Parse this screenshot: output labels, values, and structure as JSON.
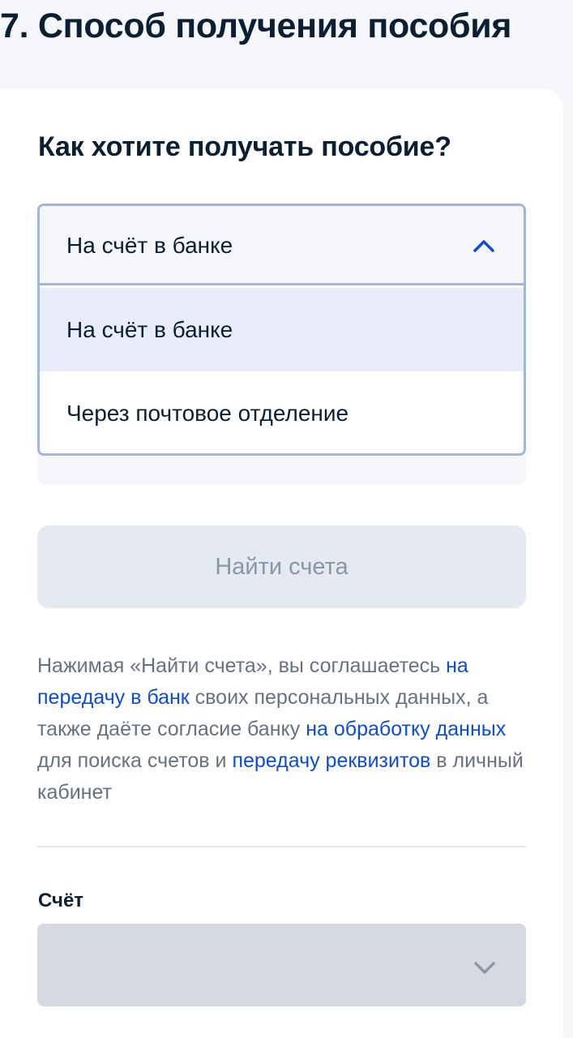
{
  "section": {
    "title": "7. Способ получения пособия"
  },
  "form": {
    "question": "Как хотите получать пособие?",
    "payment_method": {
      "selected": "На счёт в банке",
      "expanded": true,
      "options": [
        {
          "label": "На счёт в банке",
          "selected": true
        },
        {
          "label": "Через почтовое отделение",
          "selected": false
        }
      ],
      "icon": "chevron-up-icon"
    },
    "find_button": {
      "label": "Найти счета",
      "disabled": true
    },
    "consent": {
      "part1": "Нажимая «Найти счета», вы соглашаетесь ",
      "link1": "на передачу в банк",
      "part2": " своих персональных данных, а также даёте согласие банку ",
      "link2": "на обработку данных",
      "part3": " для поиска счетов и ",
      "link3": "передачу реквизитов",
      "part4": " в личный кабинет"
    },
    "account": {
      "label": "Счёт",
      "value": "",
      "disabled": true,
      "icon": "chevron-down-icon"
    }
  },
  "colors": {
    "accent": "#0d4cd3",
    "text": "#0b1f33",
    "muted_text": "#66727f",
    "select_border": "#a3b5db",
    "option_highlight": "#e8edf9",
    "button_disabled_bg": "#e5e9f2",
    "field_disabled_bg": "#d5d9e0"
  }
}
